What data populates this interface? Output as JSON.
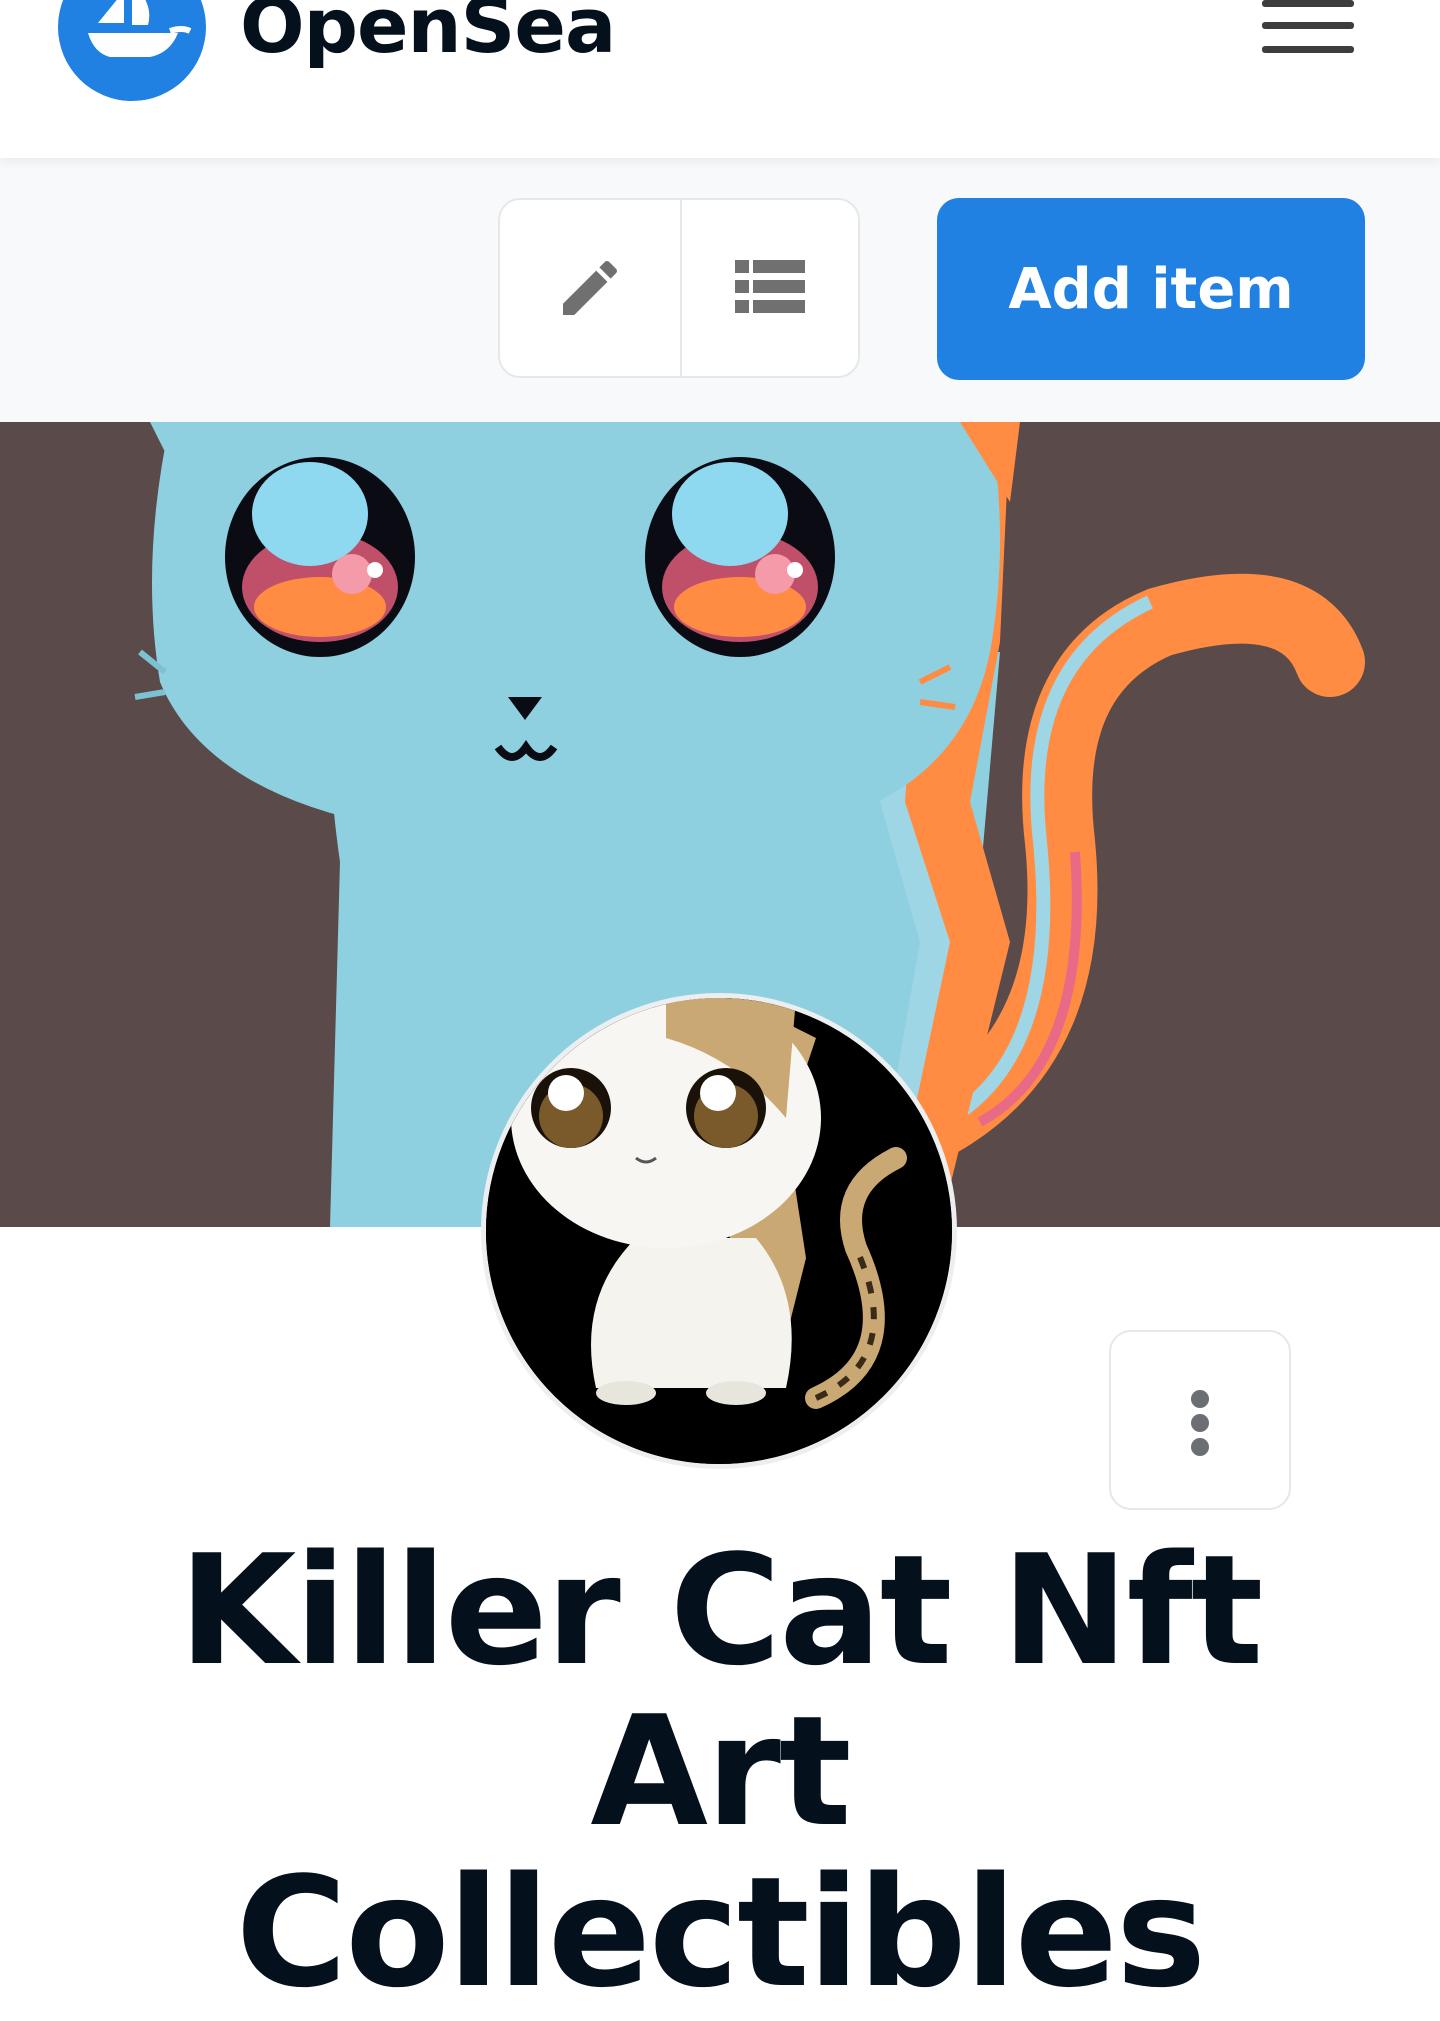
{
  "header": {
    "brand": "OpenSea",
    "logo_icon": "opensea-ship-icon",
    "menu_icon": "hamburger-menu-icon"
  },
  "toolbar": {
    "edit_icon": "pencil-icon",
    "list_icon": "list-icon",
    "add_item_label": "Add item"
  },
  "collection": {
    "title_line1": "Killer Cat Nft Art",
    "title_line2": "Collectibles"
  },
  "more_icon": "vertical-dots-icon",
  "colors": {
    "brand_blue": "#2081e2",
    "title_text": "#04111d",
    "banner_bg": "#5a4a4a",
    "cat_blue": "#8fd0e0"
  }
}
